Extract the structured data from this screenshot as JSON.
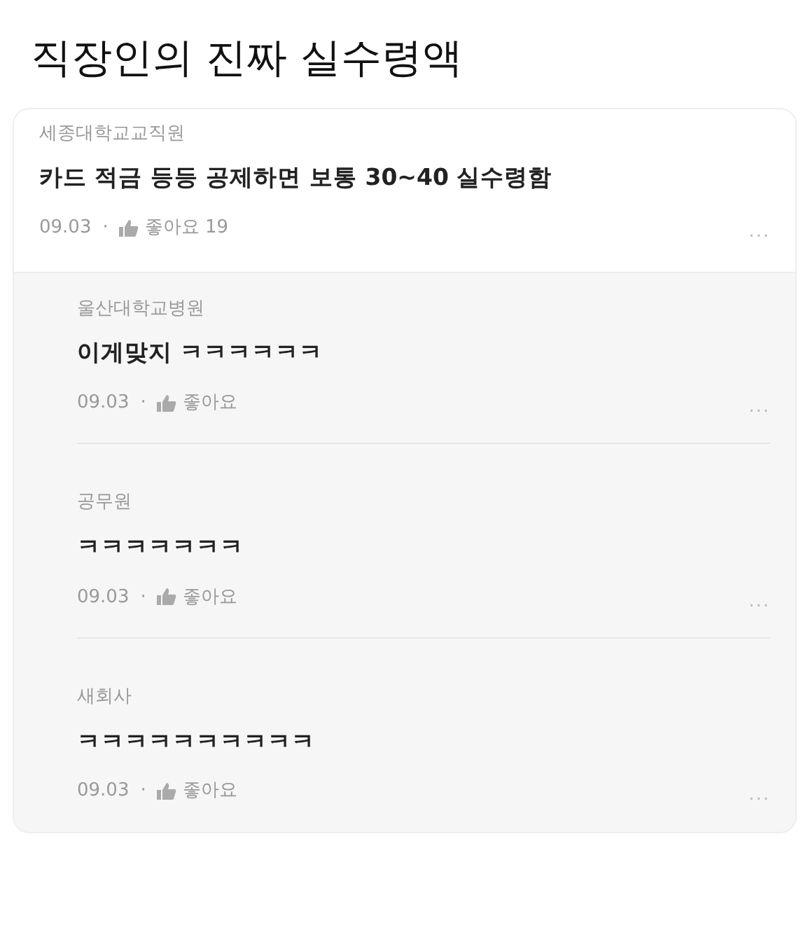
{
  "title": "직장인의 진짜 실수령액",
  "comment": {
    "author": "세종대학교교직원",
    "text": "카드 적금 등등 공제하면 보통 30~40 실수령함",
    "date": "09.03",
    "separator": "·",
    "like_label": "좋아요",
    "like_count": "19",
    "more": "..."
  },
  "replies": [
    {
      "author": "울산대학교병원",
      "text": "이게맞지 ㅋㅋㅋㅋㅋㅋ",
      "date": "09.03",
      "separator": "·",
      "like_label": "좋아요",
      "more": "..."
    },
    {
      "author": "공무원",
      "text": "ㅋㅋㅋㅋㅋㅋㅋ",
      "date": "09.03",
      "separator": "·",
      "like_label": "좋아요",
      "more": "..."
    },
    {
      "author": "새회사",
      "text": "ㅋㅋㅋㅋㅋㅋㅋㅋㅋㅋ",
      "date": "09.03",
      "separator": "·",
      "like_label": "좋아요",
      "more": "..."
    }
  ]
}
